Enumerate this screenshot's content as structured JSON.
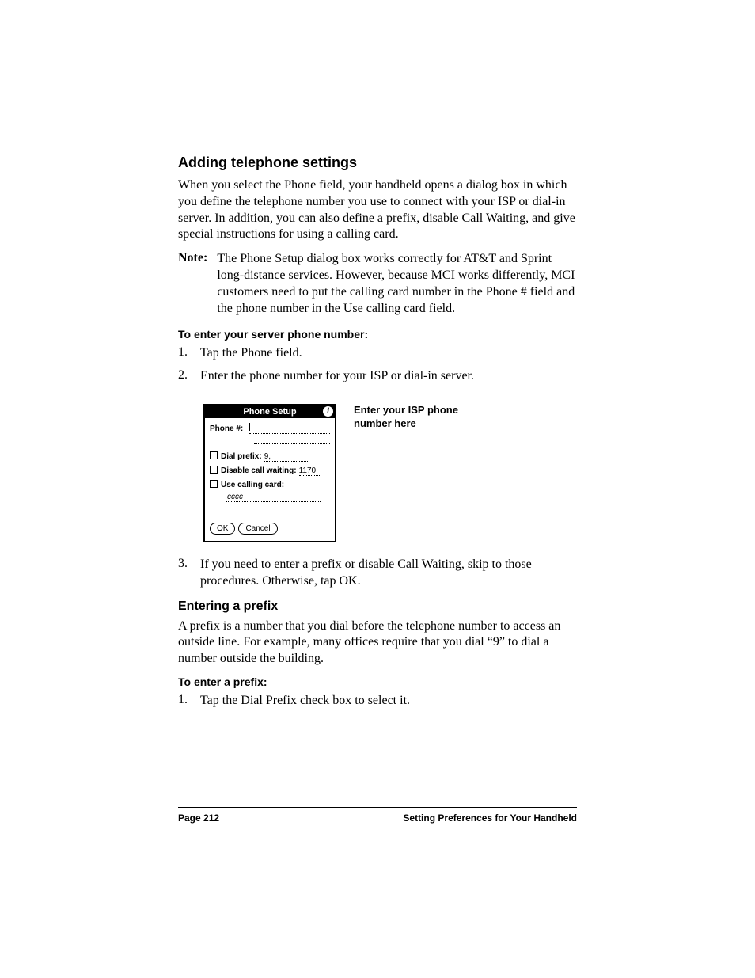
{
  "headings": {
    "h1": "Adding telephone settings",
    "h2": "Entering a prefix"
  },
  "paragraphs": {
    "p1": "When you select the Phone field, your handheld opens a dialog box in which you define the telephone number you use to connect with your ISP or dial-in server. In addition, you can also define a prefix, disable Call Waiting, and give special instructions for using a calling card.",
    "p2": "A prefix is a number that you dial before the telephone number to access an outside line. For example, many offices require that you dial “9” to dial a number outside the building."
  },
  "note": {
    "label": "Note:",
    "text": "The Phone Setup dialog box works correctly for AT&T and Sprint long-distance services. However, because MCI works differently, MCI customers need to put the calling card number in the Phone # field and the phone number in the Use calling card field."
  },
  "subheadings": {
    "s1": "To enter your server phone number:",
    "s2": "To enter a prefix:"
  },
  "steps": {
    "list1": {
      "item1_num": "1.",
      "item1_text": "Tap the Phone field.",
      "item2_num": "2.",
      "item2_text": "Enter the phone number for your ISP or dial-in server.",
      "item3_num": "3.",
      "item3_text": "If you need to enter a prefix or disable Call Waiting, skip to those procedures. Otherwise, tap OK."
    },
    "list2": {
      "item1_num": "1.",
      "item1_text": "Tap the Dial Prefix check box to select it."
    }
  },
  "dialog": {
    "title": "Phone Setup",
    "info_icon_text": "i",
    "phone_label": "Phone #:",
    "dial_prefix_label": "Dial prefix:",
    "dial_prefix_value": "9,",
    "disable_cw_label": "Disable call waiting:",
    "disable_cw_value": "1170,",
    "use_cc_label": "Use calling card:",
    "cc_hint": "cccc",
    "ok_label": "OK",
    "cancel_label": "Cancel"
  },
  "callout": {
    "text": "Enter your ISP phone number here"
  },
  "footer": {
    "left": "Page 212",
    "right": "Setting Preferences for Your Handheld"
  }
}
